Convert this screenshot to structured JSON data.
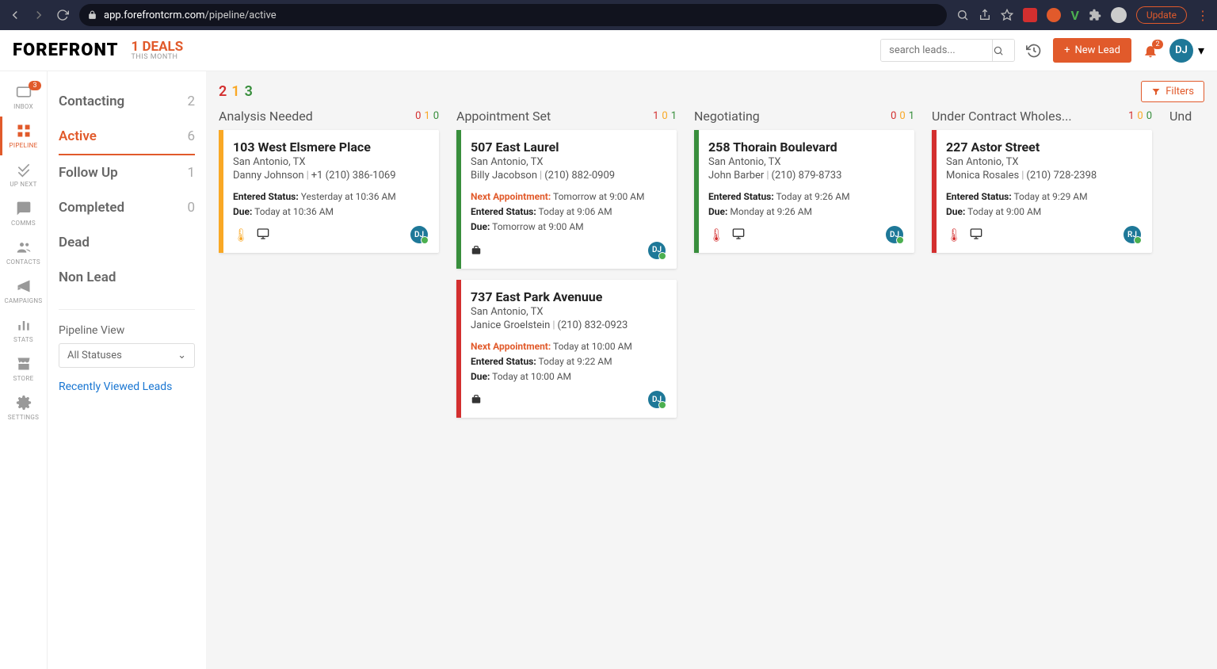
{
  "browser": {
    "url_host": "app.forefrontcrm.com",
    "url_path": "/pipeline/active",
    "update_label": "Update"
  },
  "header": {
    "logo": "FOREFRONT",
    "deals_big": "1 DEALS",
    "deals_small": "THIS MONTH",
    "search_placeholder": "search leads...",
    "new_lead_label": "New Lead",
    "notif_count": "2",
    "user_initials": "DJ"
  },
  "iconbar": [
    {
      "label": "INBOX",
      "badge": "3",
      "name": "inbox"
    },
    {
      "label": "PIPELINE",
      "name": "pipeline",
      "active": true
    },
    {
      "label": "UP NEXT",
      "name": "upnext"
    },
    {
      "label": "COMMS",
      "name": "comms"
    },
    {
      "label": "CONTACTS",
      "name": "contacts"
    },
    {
      "label": "CAMPAIGNS",
      "name": "campaigns"
    },
    {
      "label": "STATS",
      "name": "stats"
    },
    {
      "label": "STORE",
      "name": "store"
    },
    {
      "label": "SETTINGS",
      "name": "settings"
    }
  ],
  "filters": [
    {
      "label": "Contacting",
      "count": "2"
    },
    {
      "label": "Active",
      "count": "6",
      "active": true
    },
    {
      "label": "Follow Up",
      "count": "1"
    },
    {
      "label": "Completed",
      "count": "0"
    },
    {
      "label": "Dead",
      "count": ""
    },
    {
      "label": "Non Lead",
      "count": ""
    }
  ],
  "pipeline_view_label": "Pipeline View",
  "status_select": "All Statuses",
  "recent_label": "Recently Viewed Leads",
  "summary": {
    "r": "2",
    "y": "1",
    "g": "3"
  },
  "filters_btn": "Filters",
  "columns": [
    {
      "title": "Analysis Needed",
      "nums": {
        "r": "0",
        "y": "1",
        "g": "0"
      },
      "cards": [
        {
          "stripe": "yellow",
          "title": "103 West Elsmere Place",
          "loc": "San Antonio, TX",
          "person": "Danny Johnson",
          "phone": "+1 (210) 386-1069",
          "entered": "Yesterday at 10:36 AM",
          "due": "Today at 10:36 AM",
          "temp": "cold",
          "device": "desktop",
          "assignee": "DJ"
        }
      ]
    },
    {
      "title": "Appointment Set",
      "nums": {
        "r": "1",
        "y": "0",
        "g": "1"
      },
      "cards": [
        {
          "stripe": "green",
          "title": "507 East Laurel",
          "loc": "San Antonio, TX",
          "person": "Billy Jacobson",
          "phone": "(210) 882-0909",
          "next_appt": "Tomorrow at 9:00 AM",
          "entered": "Today at 9:06 AM",
          "due": "Tomorrow at 9:00 AM",
          "bag": true,
          "assignee": "DJ"
        },
        {
          "stripe": "red",
          "title": "737 East Park Avenuue",
          "loc": "San Antonio, TX",
          "person": "Janice Groelstein",
          "phone": "(210) 832-0923",
          "next_appt": "Today at 10:00 AM",
          "entered": "Today at 9:22 AM",
          "due": "Today at 10:00 AM",
          "bag": true,
          "assignee": "DJ"
        }
      ]
    },
    {
      "title": "Negotiating",
      "nums": {
        "r": "0",
        "y": "0",
        "g": "1"
      },
      "cards": [
        {
          "stripe": "green",
          "title": "258 Thorain Boulevard",
          "loc": "San Antonio, TX",
          "person": "John Barber",
          "phone": "(210) 879-8733",
          "entered": "Today at 9:26 AM",
          "due": "Monday at 9:26 AM",
          "temp": "hot",
          "device": "desktop",
          "assignee": "DJ"
        }
      ]
    },
    {
      "title": "Under Contract Wholes...",
      "nums": {
        "r": "1",
        "y": "0",
        "g": "0"
      },
      "cards": [
        {
          "stripe": "red",
          "title": "227 Astor Street",
          "loc": "San Antonio, TX",
          "person": "Monica Rosales",
          "phone": "(210) 728-2398",
          "entered": "Today at 9:29 AM",
          "due": "Today at 9:00 AM",
          "temp": "hot",
          "device": "desktop",
          "assignee": "RJ"
        }
      ]
    },
    {
      "title": "Und",
      "nums": {},
      "cards": []
    }
  ]
}
